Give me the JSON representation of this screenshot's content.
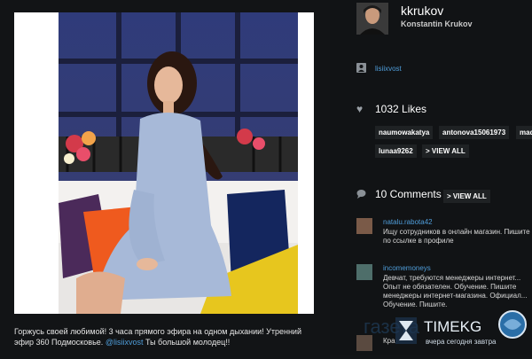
{
  "post": {
    "caption_text": "Горжусь своей любимой! 3 часа прямого эфира на одном дыхании! Утренний эфир 360 Подмосковье.",
    "caption_mention": "@lisiixvost",
    "caption_tail": "Ты большой молодец!!"
  },
  "profile": {
    "username": "kkrukov",
    "full_name": "Konstantin Krukov"
  },
  "tagged": {
    "user": "lisiixvost"
  },
  "likes": {
    "count_label": "1032 Likes",
    "users": [
      "naumowakatya",
      "antonova15061973",
      "mad",
      "lunaa9262"
    ],
    "view_all": "> VIEW ALL"
  },
  "comments": {
    "count_label": "10 Comments",
    "view_all": "> VIEW ALL",
    "items": [
      {
        "user": "natalu.rabota42",
        "text": "Ищу сотрудников в онлайн магазин. Пишите по ссылке в профиле"
      },
      {
        "user": "incomemoneys",
        "text": "Девчат, требуются менеджеры интернет... Опыт не обязателен. Обучение. Пишите менеджеры интернет-магазина. Официал... Обучение. Пишите."
      },
      {
        "user": "",
        "text": "Кра"
      }
    ]
  },
  "watermark": {
    "brand": "TIMEKG",
    "tagline": "вчера сегодня завтра",
    "back_text": "газета"
  }
}
